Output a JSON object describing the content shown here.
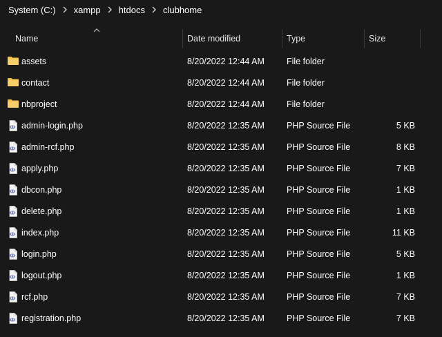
{
  "breadcrumb": [
    {
      "label": "System (C:)"
    },
    {
      "label": "xampp"
    },
    {
      "label": "htdocs"
    },
    {
      "label": "clubhome"
    }
  ],
  "columns": {
    "name": "Name",
    "date": "Date modified",
    "type": "Type",
    "size": "Size"
  },
  "sort": {
    "column": "Name",
    "direction": "ascending"
  },
  "colors": {
    "background": "#191919",
    "text": "#ffffff",
    "folder": "#f2c14e",
    "php_icon": "#8892be"
  },
  "files": [
    {
      "name": "assets",
      "date": "8/20/2022 12:44 AM",
      "type": "File folder",
      "size": "",
      "icon": "folder-icon"
    },
    {
      "name": "contact",
      "date": "8/20/2022 12:44 AM",
      "type": "File folder",
      "size": "",
      "icon": "folder-icon"
    },
    {
      "name": "nbproject",
      "date": "8/20/2022 12:44 AM",
      "type": "File folder",
      "size": "",
      "icon": "folder-icon"
    },
    {
      "name": "admin-login.php",
      "date": "8/20/2022 12:35 AM",
      "type": "PHP Source File",
      "size": "5 KB",
      "icon": "php-file-icon"
    },
    {
      "name": "admin-rcf.php",
      "date": "8/20/2022 12:35 AM",
      "type": "PHP Source File",
      "size": "8 KB",
      "icon": "php-file-icon"
    },
    {
      "name": "apply.php",
      "date": "8/20/2022 12:35 AM",
      "type": "PHP Source File",
      "size": "7 KB",
      "icon": "php-file-icon"
    },
    {
      "name": "dbcon.php",
      "date": "8/20/2022 12:35 AM",
      "type": "PHP Source File",
      "size": "1 KB",
      "icon": "php-file-icon"
    },
    {
      "name": "delete.php",
      "date": "8/20/2022 12:35 AM",
      "type": "PHP Source File",
      "size": "1 KB",
      "icon": "php-file-icon"
    },
    {
      "name": "index.php",
      "date": "8/20/2022 12:35 AM",
      "type": "PHP Source File",
      "size": "11 KB",
      "icon": "php-file-icon"
    },
    {
      "name": "login.php",
      "date": "8/20/2022 12:35 AM",
      "type": "PHP Source File",
      "size": "5 KB",
      "icon": "php-file-icon"
    },
    {
      "name": "logout.php",
      "date": "8/20/2022 12:35 AM",
      "type": "PHP Source File",
      "size": "1 KB",
      "icon": "php-file-icon"
    },
    {
      "name": "rcf.php",
      "date": "8/20/2022 12:35 AM",
      "type": "PHP Source File",
      "size": "7 KB",
      "icon": "php-file-icon"
    },
    {
      "name": "registration.php",
      "date": "8/20/2022 12:35 AM",
      "type": "PHP Source File",
      "size": "7 KB",
      "icon": "php-file-icon"
    }
  ]
}
